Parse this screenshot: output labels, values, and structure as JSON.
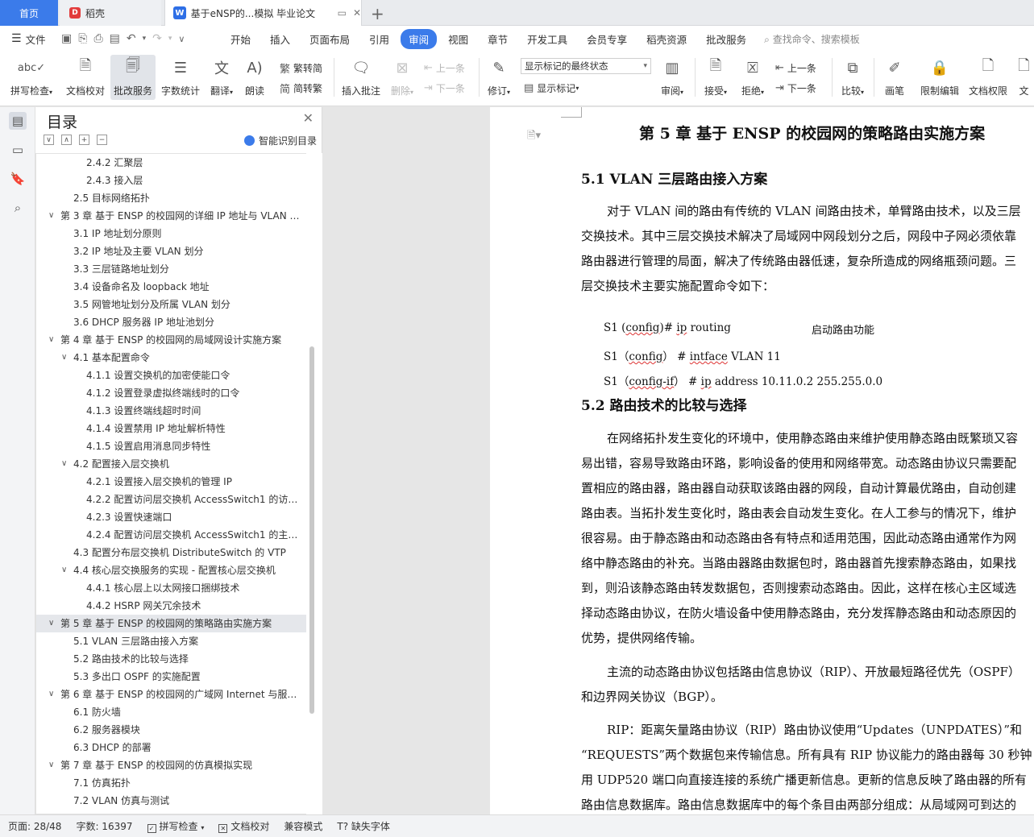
{
  "tabs": {
    "home": "首页",
    "daoke": "稻壳",
    "active_doc": "基于eNSP的...模拟 毕业论文"
  },
  "menubar": {
    "file": "文件",
    "items": [
      "开始",
      "插入",
      "页面布局",
      "引用",
      "审阅",
      "视图",
      "章节",
      "开发工具",
      "会员专享",
      "稻壳资源",
      "批改服务"
    ],
    "active": "审阅",
    "search_placeholder": "查找命令、搜索模板"
  },
  "ribbon": {
    "spell_check": "拼写检查",
    "doc_check": "文档校对",
    "correction_service": "批改服务",
    "word_count": "字数统计",
    "translate": "翻译",
    "read_aloud": "朗读",
    "to_traditional": "繁转简",
    "to_simplified": "简转繁",
    "insert_comment": "插入批注",
    "delete": "删除",
    "prev_comment": "上一条",
    "next_comment": "下一条",
    "track_changes": "修订",
    "display_mode": "显示标记的最终状态",
    "show_markup": "显示标记",
    "review": "审阅",
    "accept": "接受",
    "reject": "拒绝",
    "prev_change": "上一条",
    "next_change": "下一条",
    "compare": "比较",
    "pen": "画笔",
    "restrict_edit": "限制编辑",
    "doc_rights": "文档权限",
    "doc_cut": "文"
  },
  "toc": {
    "title": "目录",
    "smart": "智能识别目录",
    "items": [
      {
        "level": 3,
        "text": "2.4.2 汇聚层"
      },
      {
        "level": 3,
        "text": "2.4.3 接入层"
      },
      {
        "level": 2,
        "text": "2.5 目标网络拓扑"
      },
      {
        "level": 1,
        "text": "第 3 章  基于 ENSP 的校园网的详细 IP 地址与 VLAN …",
        "chev": "∨"
      },
      {
        "level": 2,
        "text": "3.1 IP 地址划分原则"
      },
      {
        "level": 2,
        "text": "3.2 IP 地址及主要 VLAN 划分"
      },
      {
        "level": 2,
        "text": "3.3 三层链路地址划分"
      },
      {
        "level": 2,
        "text": "3.4 设备命名及 loopback 地址"
      },
      {
        "level": 2,
        "text": "3.5 网管地址划分及所属 VLAN 划分"
      },
      {
        "level": 2,
        "text": "3.6 DHCP 服务器 IP 地址池划分"
      },
      {
        "level": 1,
        "text": "第 4 章  基于 ENSP 的校园网的局域网设计实施方案",
        "chev": "∨"
      },
      {
        "level": 2,
        "text": "4.1 基本配置命令",
        "chev": "∨"
      },
      {
        "level": 3,
        "text": "4.1.1 设置交换机的加密使能口令"
      },
      {
        "level": 3,
        "text": "4.1.2 设置登录虚拟终端线时的口令"
      },
      {
        "level": 3,
        "text": "4.1.3 设置终端线超时时间"
      },
      {
        "level": 3,
        "text": "4.1.4 设置禁用 IP 地址解析特性"
      },
      {
        "level": 3,
        "text": "4.1.5 设置启用消息同步特性"
      },
      {
        "level": 2,
        "text": "4.2 配置接入层交换机",
        "chev": "∨"
      },
      {
        "level": 3,
        "text": "4.2.1 设置接入层交换机的管理 IP"
      },
      {
        "level": 3,
        "text": "4.2.2 配置访问层交换机 AccessSwitch1 的访问…"
      },
      {
        "level": 3,
        "text": "4.2.3 设置快速端口"
      },
      {
        "level": 3,
        "text": "4.2.4 配置访问层交换机 AccessSwitch1 的主干…"
      },
      {
        "level": 2,
        "text": "4.3  配置分布层交换机 DistributeSwitch 的 VTP"
      },
      {
        "level": 2,
        "text": "4.4  核心层交换服务的实现 - 配置核心层交换机",
        "chev": "∨"
      },
      {
        "level": 3,
        "text": "4.4.1 核心层上以太网接口捆绑技术"
      },
      {
        "level": 3,
        "text": "4.4.2 HSRP 网关冗余技术"
      },
      {
        "level": 1,
        "text": "第 5 章  基于 ENSP 的校园网的策略路由实施方案",
        "chev": "∨",
        "selected": true
      },
      {
        "level": 2,
        "text": "5.1 VLAN 三层路由接入方案"
      },
      {
        "level": 2,
        "text": "5.2 路由技术的比较与选择"
      },
      {
        "level": 2,
        "text": "5.3 多出口 OSPF 的实施配置"
      },
      {
        "level": 1,
        "text": "第 6 章  基于 ENSP 的校园网的广域网 Internet 与服…",
        "chev": "∨"
      },
      {
        "level": 2,
        "text": "6.1 防火墙"
      },
      {
        "level": 2,
        "text": "6.2 服务器模块"
      },
      {
        "level": 2,
        "text": "6.3 DHCP 的部署"
      },
      {
        "level": 1,
        "text": "第 7 章  基于 ENSP 的校园网的仿真模拟实现",
        "chev": "∨"
      },
      {
        "level": 2,
        "text": "7.1 仿真拓扑"
      },
      {
        "level": 2,
        "text": "7.2 VLAN 仿真与测试"
      }
    ]
  },
  "document": {
    "chapter": "第 5 章  基于 ENSP 的校园网的策略路由实施方案",
    "sec1": "5.1 VLAN 三层路由接入方案",
    "sec1_lines": [
      "对于 VLAN 间的路由有传统的 VLAN 间路由技术，单臂路由技术，以及三层",
      "交换技术。其中三层交换技术解决了局域网中网段划分之后，网段中子网必须依靠",
      "路由器进行管理的局面，解决了传统路由器低速，复杂所造成的网络瓶颈问题。三",
      "层交换技术主要实施配置命令如下："
    ],
    "cmd1_a": "S1 (",
    "cmd1_b": "config",
    "cmd1_c": ")# ",
    "cmd1_d": "ip",
    "cmd1_e": " routing",
    "cmd1_note": "启动路由功能",
    "cmd2_a": "S1（",
    "cmd2_b": "config",
    "cmd2_c": "）  # ",
    "cmd2_d": "intface",
    "cmd2_e": " VLAN 11",
    "cmd3_a": "S1（",
    "cmd3_b": "config-if",
    "cmd3_c": "）  # ",
    "cmd3_d": "ip",
    "cmd3_e": " address 10.11.0.2 255.255.0.0",
    "sec2": "5.2 路由技术的比较与选择",
    "sec2_lines": [
      "在网络拓扑发生变化的环境中，使用静态路由来维护使用静态路由既繁琐又容",
      "易出错，容易导致路由环路，影响设备的使用和网络带宽。动态路由协议只需要配",
      "置相应的路由器，路由器自动获取该路由器的网段，自动计算最优路由，自动创建",
      "路由表。当拓扑发生变化时，路由表会自动发生变化。在人工参与的情况下，维护",
      "很容易。由于静态路由和动态路由各有特点和适用范围，因此动态路由通常作为网",
      "络中静态路由的补充。当路由器路由数据包时，路由器首先搜索静态路由，如果找",
      "到，则沿该静态路由转发数据包，否则搜索动态路由。因此，这样在核心主区域选",
      "择动态路由协议，在防火墙设备中使用静态路由，充分发挥静态路由和动态原因的",
      "优势，提供网络传输。"
    ],
    "para3_lines": [
      "主流的动态路由协议包括路由信息协议（RIP）、开放最短路径优先（OSPF）",
      "和边界网关协议（BGP）。"
    ],
    "para4_lines": [
      "RIP：距离矢量路由协议（RIP）路由协议使用“Updates（UNPDATES）”和",
      "“REQUESTS”两个数据包来传输信息。所有具有 RIP 协议能力的路由器每 30 秒钟",
      "用 UDP520 端口向直接连接的系统广播更新信息。更新的信息反映了路由器的所有",
      "路由信息数据库。路由信息数据库中的每个条目由两部分组成：从局域网可到达的"
    ]
  },
  "status": {
    "page": "页面: 28/48",
    "words": "字数: 16397",
    "spell": "拼写检查",
    "proof": "文档校对",
    "compat": "兼容模式",
    "missing_font": "缺失字体"
  }
}
